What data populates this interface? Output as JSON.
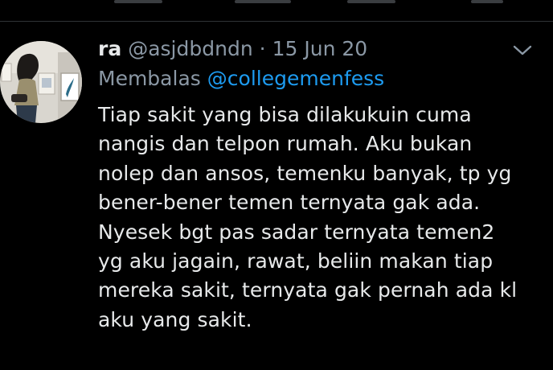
{
  "tweet": {
    "display_name": "ra",
    "handle": "@asjdbdndn",
    "separator": "·",
    "date": "15 Jun 20",
    "reply_label": "Membalas",
    "reply_to": "@collegemenfess",
    "text": "Tiap sakit yang bisa dilakukuin cuma\nnangis dan telpon rumah. Aku bukan\nnolep dan ansos, temenku banyak, tp yg\nbener-bener temen ternyata gak ada.\nNyesek bgt pas sadar ternyata temen2\nyg aku jagain, rawat, beliin makan tiap\nmereka sakit, ternyata gak pernah ada kl\naku yang sakit."
  },
  "icons": {
    "more_menu": "chevron-down-icon",
    "avatar": "profile-avatar"
  },
  "colors": {
    "background": "#000000",
    "primary_text": "#e7e9ea",
    "secondary_text": "#8b98a5",
    "link": "#1d9bf0",
    "divider": "#2f3336"
  }
}
